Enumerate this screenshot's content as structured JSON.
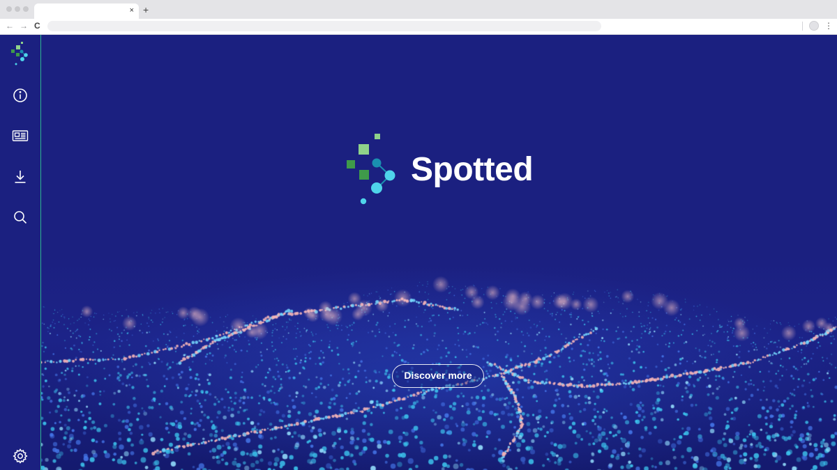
{
  "browser": {
    "tab_close": "×",
    "new_tab": "+",
    "nav": {
      "back": "←",
      "forward": "→",
      "reload": "C"
    },
    "menu": "⋮"
  },
  "sidebar": {
    "items": [
      {
        "icon": "logo-icon"
      },
      {
        "icon": "info-icon"
      },
      {
        "icon": "news-icon"
      },
      {
        "icon": "download-icon"
      },
      {
        "icon": "search-icon"
      },
      {
        "icon": "settings-icon"
      }
    ],
    "accent_color": "#2fb58f"
  },
  "hero": {
    "brand_name": "Spotted",
    "cta_label": "Discover more",
    "background_color": "#1b2080"
  },
  "colors": {
    "logo_light_green": "#8fd28a",
    "logo_green": "#3f9a4a",
    "logo_teal": "#1a8fb0",
    "logo_cyan": "#4fd4ea",
    "particle_cyan": "#3ec8f0",
    "particle_pink": "#f5b5b8"
  }
}
